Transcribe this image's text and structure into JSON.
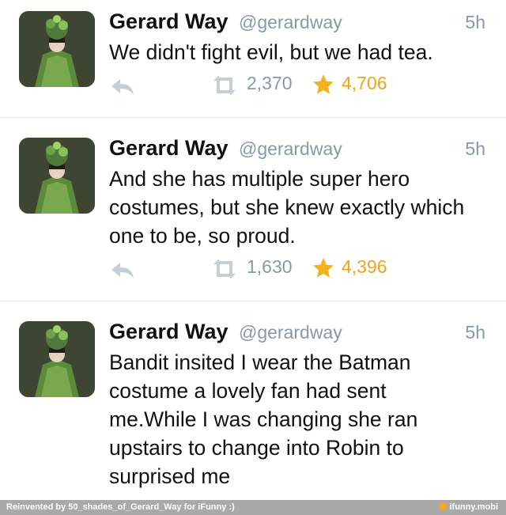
{
  "tweets": [
    {
      "name": "Gerard Way",
      "handle": "@gerardway",
      "time": "5h",
      "text": "We didn't fight evil, but we had tea.",
      "retweets": "2,370",
      "favorites": "4,706",
      "avatar_icon": "profile-avatar"
    },
    {
      "name": "Gerard Way",
      "handle": "@gerardway",
      "time": "5h",
      "text": "And she has multiple super hero costumes, but she knew exactly which one to be, so proud.",
      "retweets": "1,630",
      "favorites": "4,396",
      "avatar_icon": "profile-avatar"
    },
    {
      "name": "Gerard Way",
      "handle": "@gerardway",
      "time": "5h",
      "text": "Bandit insited I wear the Batman costume a lovely fan had sent me.While I was changing she ran upstairs to change into Robin to surprised me",
      "avatar_icon": "profile-avatar"
    }
  ],
  "footer": {
    "left": "Reinvented by 50_shades_of_Gerard_Way for iFunny :)",
    "right": "ifunny.mobi"
  },
  "icons": {
    "reply": "reply-icon",
    "retweet": "retweet-icon",
    "favorite": "star-icon"
  },
  "colors": {
    "muted": "#8899a6",
    "favorite": "#f0a318",
    "footer_bg": "#a9a9a9"
  }
}
